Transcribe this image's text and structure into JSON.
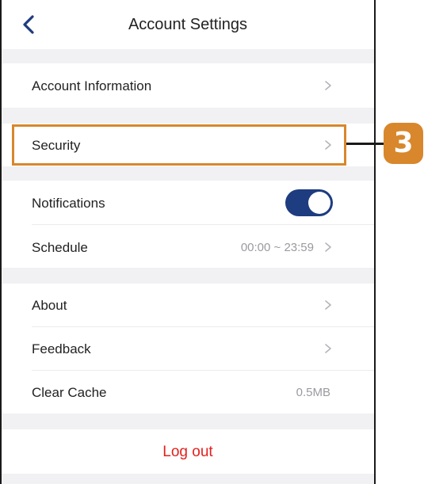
{
  "header": {
    "title": "Account Settings",
    "back_icon": "chevron-left-icon"
  },
  "sections": {
    "account_information": {
      "label": "Account Information"
    },
    "security": {
      "label": "Security"
    },
    "notifications": {
      "label": "Notifications",
      "toggle_on": true
    },
    "schedule": {
      "label": "Schedule",
      "value": "00:00 ~ 23:59"
    },
    "about": {
      "label": "About"
    },
    "feedback": {
      "label": "Feedback"
    },
    "clear_cache": {
      "label": "Clear Cache",
      "value": "0.5MB"
    }
  },
  "logout": {
    "label": "Log out"
  },
  "annotation": {
    "step_number": "3"
  },
  "colors": {
    "accent_toggle": "#1e3c80",
    "logout_red": "#e3201c",
    "highlight_orange": "#d8872c",
    "section_gap": "#f1f1f4"
  }
}
